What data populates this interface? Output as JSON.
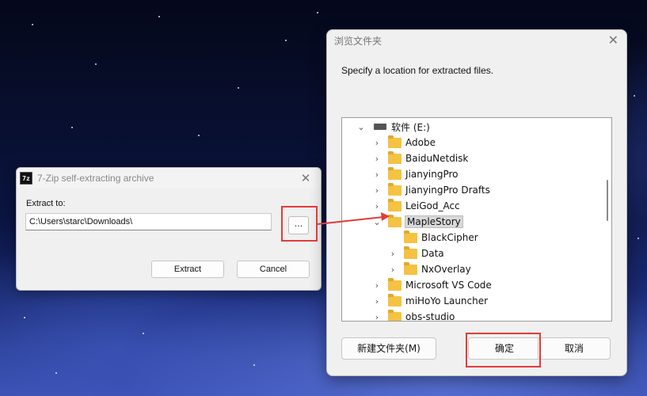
{
  "sfx_window": {
    "title": "7-Zip self-extracting archive",
    "app_icon_text": "7z",
    "extract_label": "Extract to:",
    "path_value": "C:\\Users\\starc\\Downloads\\",
    "browse_label": "...",
    "extract_button": "Extract",
    "cancel_button": "Cancel"
  },
  "browse_dialog": {
    "title": "浏览文件夹",
    "description": "Specify a location for extracted files.",
    "tree": {
      "drive": "软件 (E:)",
      "items": [
        {
          "label": "Adobe"
        },
        {
          "label": "BaiduNetdisk"
        },
        {
          "label": "JianyingPro"
        },
        {
          "label": "JianyingPro Drafts"
        },
        {
          "label": "LeiGod_Acc"
        },
        {
          "label": "MapleStory",
          "selected": true
        },
        {
          "label": "BlackCipher"
        },
        {
          "label": "Data"
        },
        {
          "label": "NxOverlay"
        },
        {
          "label": "Microsoft VS Code"
        },
        {
          "label": "miHoYo Launcher"
        },
        {
          "label": "obs-studio"
        }
      ]
    },
    "new_folder_button": "新建文件夹(M)",
    "ok_button": "确定",
    "cancel_button": "取消"
  },
  "annotation_color": "#e23b3b"
}
